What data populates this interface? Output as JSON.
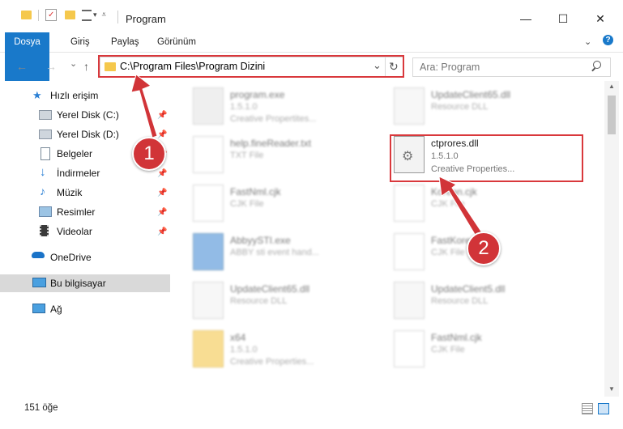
{
  "window": {
    "title": "Program",
    "controls": {
      "minimize": "—",
      "maximize": "☐",
      "close": "✕"
    }
  },
  "ribbon": {
    "tabs": [
      "Dosya",
      "Giriş",
      "Paylaş",
      "Görünüm"
    ],
    "help": "?"
  },
  "address": {
    "path": "C:\\Program Files\\Program Dizini",
    "dropdown": "⌄",
    "refresh": "↻"
  },
  "nav_buttons": {
    "back": "←",
    "forward": "→",
    "recent": "⌄",
    "up": "↑"
  },
  "search": {
    "placeholder": "Ara: Program",
    "icon": "search-icon"
  },
  "sidebar": {
    "items": [
      {
        "label": "Hızlı erişim",
        "icon": "star-icon"
      },
      {
        "label": "Yerel Disk (C:)",
        "icon": "drive-icon",
        "pinned": true
      },
      {
        "label": "Yerel Disk (D:)",
        "icon": "drive-icon",
        "pinned": true
      },
      {
        "label": "Belgeler",
        "icon": "documents-icon",
        "pinned": true
      },
      {
        "label": "İndirmeler",
        "icon": "download-icon",
        "pinned": true
      },
      {
        "label": "Müzik",
        "icon": "music-icon",
        "pinned": true
      },
      {
        "label": "Resimler",
        "icon": "pictures-icon",
        "pinned": true
      },
      {
        "label": "Videolar",
        "icon": "videos-icon",
        "pinned": true
      },
      {
        "label": "OneDrive",
        "icon": "cloud-icon"
      },
      {
        "label": "Bu bilgisayar",
        "icon": "computer-icon",
        "selected": true
      },
      {
        "label": "Ağ",
        "icon": "network-icon"
      }
    ]
  },
  "files": [
    {
      "name": "program.exe",
      "line2": "1.5.1.0",
      "line3": "Creative Propertites...",
      "icon": "exe-icon"
    },
    {
      "name": "UpdateClient65.dll",
      "line2": "Resource DLL",
      "line3": "",
      "icon": "dll-icon"
    },
    {
      "name": "help.fineReader.txt",
      "line2": "TXT File",
      "line3": "",
      "icon": "txt-icon"
    },
    {
      "name": "ctprores.dll",
      "line2": "1.5.1.0",
      "line3": "Creative Properties...",
      "icon": "dll-icon",
      "highlighted": true
    },
    {
      "name": "FastNml.cjk",
      "line2": "CJK File",
      "line3": "",
      "icon": "file-icon"
    },
    {
      "name": "Korean.cjk",
      "line2": "CJK File",
      "line3": "",
      "icon": "file-icon"
    },
    {
      "name": "AbbyySTI.exe",
      "line2": "ABBY sti event hand...",
      "line3": "",
      "icon": "exe-icon"
    },
    {
      "name": "FastKorean.cjk",
      "line2": "CJK File",
      "line3": "",
      "icon": "file-icon"
    },
    {
      "name": "UpdateClient65.dll",
      "line2": "Resource DLL",
      "line3": "",
      "icon": "dll-icon"
    },
    {
      "name": "UpdateClient5.dll",
      "line2": "Resource DLL",
      "line3": "",
      "icon": "dll-icon"
    },
    {
      "name": "x64",
      "line2": "1.5.1.0",
      "line3": "Creative Properties...",
      "icon": "folder-icon"
    },
    {
      "name": "FastNml.cjk",
      "line2": "CJK File",
      "line3": "",
      "icon": "file-icon"
    }
  ],
  "status": {
    "count": "151 öğe"
  },
  "annotations": {
    "badge1": "1",
    "badge2": "2"
  },
  "colors": {
    "accent": "#1979ca",
    "highlight": "#d9383c",
    "selected_bg": "#d9d9d9"
  }
}
